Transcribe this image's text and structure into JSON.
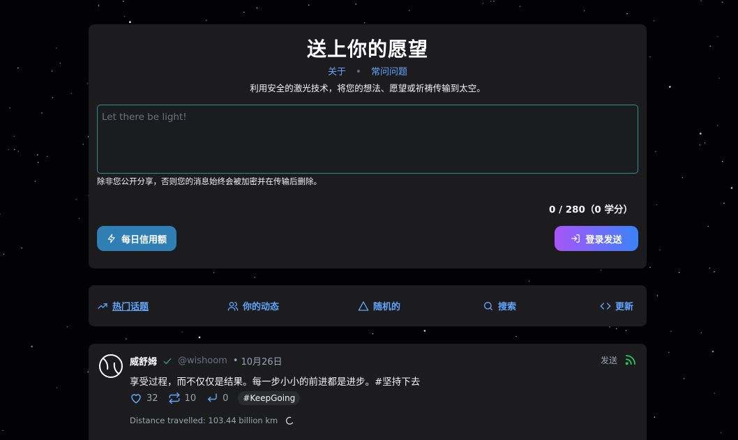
{
  "compose": {
    "title": "送上你的愿望",
    "links": [
      "关于",
      "常问问题"
    ],
    "description": "利用安全的激光技术，将您的想法、愿望或祈祷传输到太空。",
    "placeholder": "Let there be light!",
    "privacy_note": "除非您公开分享，否则您的消息始终会被加密并在传输后删除。",
    "counter": "0 / 280（0 学分）",
    "daily_credit_label": "每日信用额",
    "login_send_label": "登录发送"
  },
  "nav": {
    "items": [
      {
        "label": "热门话题",
        "icon": "trending-up-icon"
      },
      {
        "label": "你的动态",
        "icon": "users-icon"
      },
      {
        "label": "随机的",
        "icon": "triangle-icon"
      },
      {
        "label": "搜索",
        "icon": "search-icon"
      },
      {
        "label": "更新",
        "icon": "code-icon"
      }
    ]
  },
  "post": {
    "name": "威舒姆",
    "handle": "@wishoom",
    "date": "10月26日",
    "sent_label": "发送",
    "content": "享受过程，而不仅仅是结果。每一步小小的前进都是进步。#坚持下去",
    "likes": "32",
    "reposts": "10",
    "replies": "0",
    "tag": "#KeepGoing",
    "distance": "Distance travelled: 103.44 billion km"
  },
  "colors": {
    "accent": "#60a5fa",
    "verified": "#3f8f80",
    "signal": "#22c55e"
  }
}
